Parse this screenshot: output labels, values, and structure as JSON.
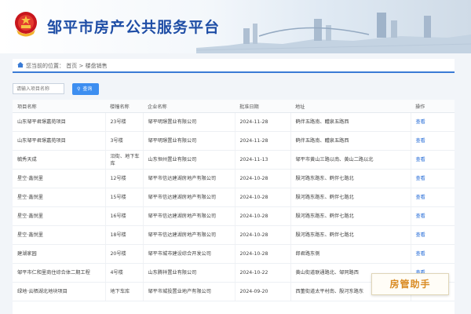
{
  "site": {
    "title": "邹平市房产公共服务平台",
    "emblem_icon": "national-emblem-icon"
  },
  "breadcrumb": {
    "prefix": "您当前的位置：",
    "home": "首页",
    "separator": ">",
    "current": "楼盘销售"
  },
  "search": {
    "placeholder": "请输入项目名称",
    "button_label": "查询"
  },
  "table": {
    "headers": [
      "项目名称",
      "楼幢名称",
      "企业名称",
      "批准日期",
      "地址",
      "操作"
    ],
    "rows": [
      [
        "山东邹平君璟嘉苑项目",
        "23号楼",
        "邹平明璟置业有限公司",
        "2024-11-28",
        "鹤伴五路南、醴泉五路西",
        "查看"
      ],
      [
        "山东邹平君璟嘉苑项目",
        "3号楼",
        "邹平明璟置业有限公司",
        "2024-11-28",
        "鹤伴五路南、醴泉五路西",
        "查看"
      ],
      [
        "毓秀天成",
        "沿街、地下车库",
        "山东恒州置业有限公司",
        "2024-11-13",
        "邹平市黄山三路以南、黄山二路以北",
        "查看"
      ],
      [
        "星空·鑫悦里",
        "12号楼",
        "邹平市信达建湖房地产有限公司",
        "2024-10-28",
        "殷河路东路东、鹤伴七路北",
        "查看"
      ],
      [
        "星空·鑫悦里",
        "15号楼",
        "邹平市信达建湖房地产有限公司",
        "2024-10-28",
        "殷河路东路东、鹤伴七路北",
        "查看"
      ],
      [
        "星空·鑫悦里",
        "16号楼",
        "邹平市信达建湖房地产有限公司",
        "2024-10-28",
        "殷河路东路东、鹤伴七路北",
        "查看"
      ],
      [
        "星空·鑫悦里",
        "18号楼",
        "邹平市信达建湖房地产有限公司",
        "2024-10-28",
        "殷河路东路东、鹤伴七路北",
        "查看"
      ],
      [
        "建湖家园",
        "20号楼",
        "邹平市城市建设综合开发公司",
        "2024-10-28",
        "郎君路东侧",
        "查看"
      ],
      [
        "邹平市仁和里商住综合体二期工程",
        "4号楼",
        "山东腾祥置业有限公司",
        "2024-10-22",
        "黄山街道联通路北、邹同路西",
        "查看"
      ],
      [
        "绿地·云栖湖北地块项目",
        "地下车库",
        "邹平市城投置业地产有限公司",
        "2024-09-20",
        "西董街道太平村南、殷河东路东",
        "查看"
      ]
    ]
  },
  "watermark": {
    "text": "房管助手"
  },
  "colors": {
    "title_blue": "#1f4ea6",
    "accent_blue": "#3a7bd5",
    "link_blue": "#2a6fd8",
    "watermark_orange": "#d98b24"
  }
}
